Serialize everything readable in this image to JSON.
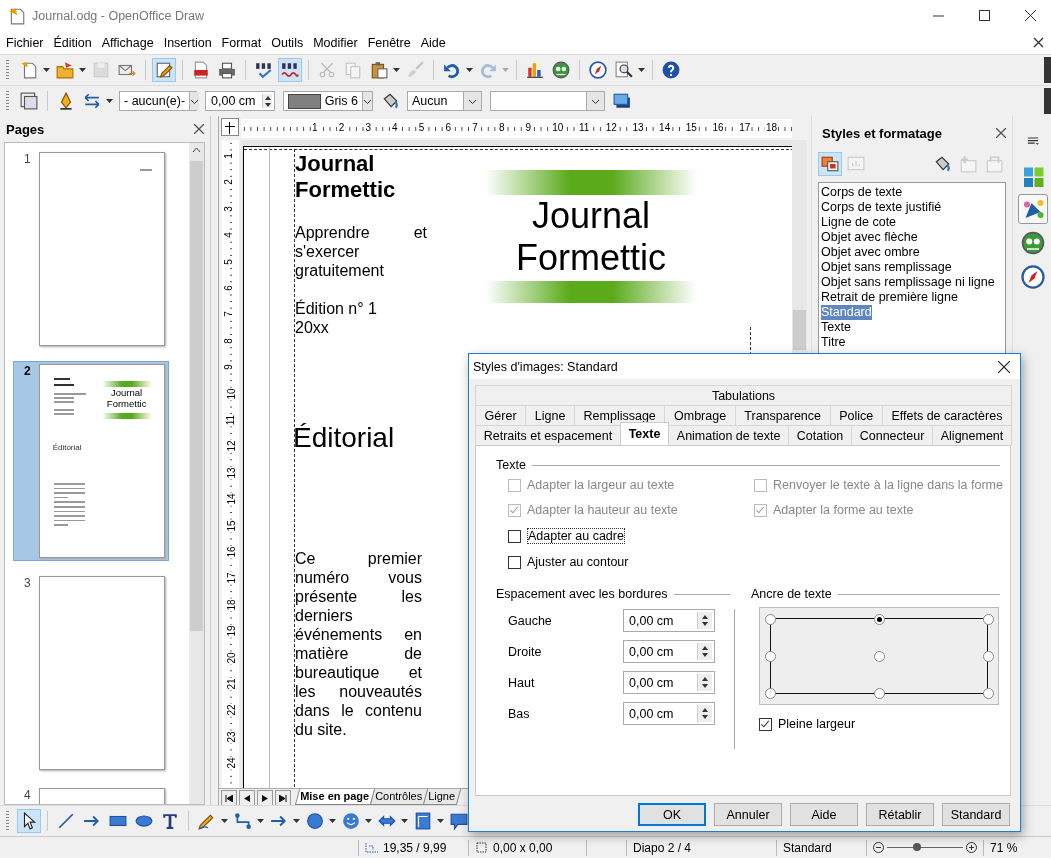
{
  "window": {
    "title": "Journal.odg - OpenOffice Draw"
  },
  "menu": [
    "Fichier",
    "Édition",
    "Affichage",
    "Insertion",
    "Format",
    "Outils",
    "Modifier",
    "Fenêtre",
    "Aide"
  ],
  "toolbar_standard": [
    {
      "kind": "newdoc",
      "menu": true,
      "active": false,
      "disabled": false
    },
    {
      "kind": "folder",
      "menu": true,
      "active": false,
      "disabled": false
    },
    {
      "kind": "disk",
      "active": false,
      "disabled": true
    },
    {
      "kind": "mail",
      "active": false,
      "disabled": false
    },
    {
      "kind": "sep"
    },
    {
      "kind": "edit",
      "active": true,
      "disabled": false
    },
    {
      "kind": "sep"
    },
    {
      "kind": "pdf",
      "active": false,
      "disabled": false
    },
    {
      "kind": "printer",
      "active": false,
      "disabled": false
    },
    {
      "kind": "sep"
    },
    {
      "kind": "spell",
      "active": false,
      "disabled": false
    },
    {
      "kind": "autospell",
      "active": true,
      "disabled": false
    },
    {
      "kind": "sep"
    },
    {
      "kind": "scissors",
      "active": false,
      "disabled": true
    },
    {
      "kind": "copy",
      "active": false,
      "disabled": true
    },
    {
      "kind": "paste",
      "menu": true,
      "active": false,
      "disabled": false
    },
    {
      "kind": "brush",
      "active": false,
      "disabled": true
    },
    {
      "kind": "sep"
    },
    {
      "kind": "undo",
      "menu": true,
      "active": false,
      "disabled": false
    },
    {
      "kind": "redo",
      "menu": true,
      "active": false,
      "disabled": true
    },
    {
      "kind": "sep"
    },
    {
      "kind": "chart",
      "active": false,
      "disabled": false
    },
    {
      "kind": "gallery",
      "active": false,
      "disabled": false
    },
    {
      "kind": "sep"
    },
    {
      "kind": "navigator",
      "active": false,
      "disabled": false
    },
    {
      "kind": "zoom",
      "menu": true,
      "active": false,
      "disabled": false
    },
    {
      "kind": "sep"
    },
    {
      "kind": "help",
      "active": false,
      "disabled": false
    }
  ],
  "toolbar_line": [
    {
      "kind": "objstyle"
    },
    {
      "kind": "sep"
    },
    {
      "kind": "pen"
    },
    {
      "kind": "arrows"
    },
    {
      "kind": "select",
      "value": "- aucun(e)-"
    },
    {
      "kind": "spin",
      "value": "0,00 cm"
    },
    {
      "kind": "colorselect",
      "value": "Gris 6"
    },
    {
      "kind": "bucket"
    },
    {
      "kind": "select",
      "value": "Aucun"
    },
    {
      "kind": "wideselect"
    },
    {
      "kind": "shadow"
    }
  ],
  "pages": {
    "title": "Pages",
    "items": [
      {
        "number": "1",
        "selected": false,
        "kind": "label"
      },
      {
        "number": "2",
        "selected": true,
        "kind": "preview",
        "banner": "Journal Formettic",
        "heading": "Éditorial"
      },
      {
        "number": "3",
        "selected": false,
        "kind": "blank"
      },
      {
        "number": "4",
        "selected": false,
        "kind": "blank"
      }
    ]
  },
  "document": {
    "hruler": [
      "1",
      "2",
      "3",
      "4",
      "5",
      "6",
      "7",
      "8",
      "9",
      "10",
      "11",
      "12",
      "13",
      "14",
      "15",
      "16",
      "17",
      "18"
    ],
    "vruler": [
      "1",
      "2",
      "3",
      "4",
      "5",
      "6",
      "7",
      "8",
      "9",
      "10",
      "11",
      "12",
      "13",
      "14",
      "15",
      "16",
      "17",
      "18",
      "19",
      "20",
      "21",
      "22",
      "23",
      "24"
    ],
    "page": {
      "title": "Journal Formettic",
      "subtitle": "Apprendre et s'exercer gratuitement",
      "edition": "Édition n° 1 20xx",
      "banner": "Journal Formettic",
      "heading": "Éditorial",
      "body": "Ce premier numéro vous présente les derniers événements en matière de bureautique et les nouveautés dans le contenu du site."
    },
    "tabs": [
      {
        "label": "Mise en page",
        "selected": true
      },
      {
        "label": "Contrôles",
        "selected": false
      },
      {
        "label": "Ligne",
        "selected": false
      }
    ]
  },
  "styles": {
    "title": "Styles et formatage",
    "tools": [
      {
        "kind": "graphic",
        "active": true,
        "disabled": false
      },
      {
        "kind": "presentation",
        "active": false,
        "disabled": true
      },
      {
        "kind": "bucket",
        "active": false,
        "disabled": false
      },
      {
        "kind": "newstyle",
        "active": false,
        "disabled": true
      },
      {
        "kind": "update",
        "active": false,
        "disabled": true
      }
    ],
    "items": [
      {
        "label": "Corps de texte",
        "selected": false
      },
      {
        "label": "Corps de texte justifié",
        "selected": false
      },
      {
        "label": "Ligne de cote",
        "selected": false
      },
      {
        "label": "Objet avec flèche",
        "selected": false
      },
      {
        "label": "Objet avec ombre",
        "selected": false
      },
      {
        "label": "Objet sans remplissage",
        "selected": false
      },
      {
        "label": "Objet sans remplissage ni ligne",
        "selected": false
      },
      {
        "label": "Retrait de première ligne",
        "selected": false
      },
      {
        "label": "Standard",
        "selected": true
      },
      {
        "label": "Texte",
        "selected": false
      },
      {
        "label": "Titre",
        "selected": false
      }
    ]
  },
  "sidebar": [
    {
      "kind": "menu",
      "selected": false
    },
    {
      "kind": "properties",
      "selected": false
    },
    {
      "kind": "styles",
      "selected": true
    },
    {
      "kind": "gallery",
      "selected": false
    },
    {
      "kind": "navigator",
      "selected": false
    }
  ],
  "draw_toolbar": [
    {
      "kind": "pointer",
      "active": true
    },
    {
      "kind": "sep"
    },
    {
      "kind": "line",
      "active": false
    },
    {
      "kind": "arrow",
      "active": false
    },
    {
      "kind": "rect",
      "active": false
    },
    {
      "kind": "ellipse",
      "active": false
    },
    {
      "kind": "text",
      "active": false
    },
    {
      "kind": "sep"
    },
    {
      "kind": "pencil",
      "menu": true,
      "active": false
    },
    {
      "kind": "connector",
      "menu": true,
      "active": false
    },
    {
      "kind": "arrow",
      "menu": true,
      "active": false
    },
    {
      "kind": "circle",
      "menu": true,
      "active": false
    },
    {
      "kind": "smiley",
      "menu": true,
      "active": false
    },
    {
      "kind": "dblarrow",
      "menu": true,
      "active": false
    },
    {
      "kind": "flowchart",
      "menu": true,
      "active": false
    },
    {
      "kind": "callout",
      "menu": true,
      "active": false
    }
  ],
  "status_bar": {
    "position": "19,35 / 9,99",
    "size": "0,00 x 0,00",
    "slide": "Diapo 2 / 4",
    "style": "Standard",
    "zoom": {
      "level": 0.4
    },
    "zoom_value": "71 %"
  },
  "dialog": {
    "title": "Styles d'images: Standard",
    "tab_rows": [
      [
        {
          "label": "Tabulations",
          "selected": false
        }
      ],
      [
        {
          "label": "Gérer",
          "selected": false
        },
        {
          "label": "Ligne",
          "selected": false
        },
        {
          "label": "Remplissage",
          "selected": false
        },
        {
          "label": "Ombrage",
          "selected": false
        },
        {
          "label": "Transparence",
          "selected": false
        },
        {
          "label": "Police",
          "selected": false
        },
        {
          "label": "Effets de caractères",
          "selected": false
        }
      ],
      [
        {
          "label": "Retraits et espacement",
          "selected": false
        },
        {
          "label": "Texte",
          "selected": true
        },
        {
          "label": "Animation de texte",
          "selected": false
        },
        {
          "label": "Cotation",
          "selected": false
        },
        {
          "label": "Connecteur",
          "selected": false
        },
        {
          "label": "Alignement",
          "selected": false
        }
      ]
    ],
    "text_section": "Texte",
    "text_options": [
      {
        "label": "Adapter la largeur au texte",
        "checked": false,
        "disabled": true
      },
      {
        "label": "Renvoyer le texte à la ligne dans la forme",
        "checked": false,
        "disabled": true
      },
      {
        "label": "Adapter la hauteur au texte",
        "checked": true,
        "disabled": true
      },
      {
        "label": "Adapter la forme au texte",
        "checked": true,
        "disabled": true
      },
      {
        "label": "Adapter au cadre",
        "checked": false,
        "disabled": false
      },
      {
        "label": "Ajuster au contour",
        "checked": false,
        "disabled": false
      }
    ],
    "spacing_section": "Espacement avec les bordures",
    "spacing": [
      {
        "label": "Gauche",
        "value": "0,00 cm"
      },
      {
        "label": "Droite",
        "value": "0,00 cm"
      },
      {
        "label": "Haut",
        "value": "0,00 cm"
      },
      {
        "label": "Bas",
        "value": "0,00 cm"
      }
    ],
    "anchor_section": "Ancre de texte",
    "anchor_points": [
      {
        "selected": false
      },
      {
        "selected": true
      },
      {
        "selected": false
      },
      {
        "selected": false
      },
      {
        "selected": false
      },
      {
        "selected": false
      },
      {
        "selected": false
      },
      {
        "selected": false
      },
      {
        "selected": false
      }
    ],
    "full_width": {
      "label": "Pleine largeur",
      "checked": true
    },
    "buttons": [
      {
        "label": "OK",
        "default": true
      },
      {
        "label": "Annuler",
        "default": false
      },
      {
        "label": "Aide",
        "default": false
      },
      {
        "label": "Rétablir",
        "default": false
      },
      {
        "label": "Standard",
        "default": false
      }
    ]
  }
}
